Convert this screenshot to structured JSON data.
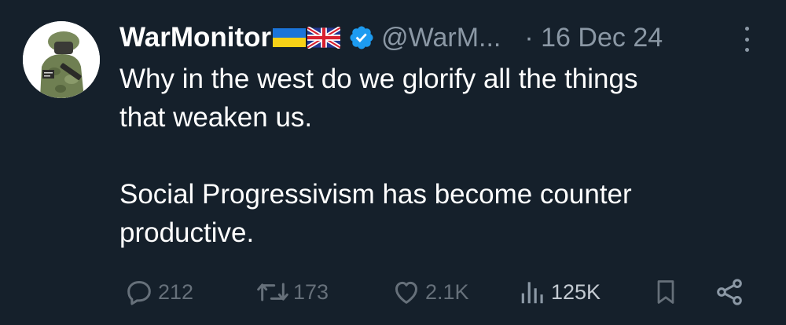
{
  "tweet": {
    "display_name": "WarMonitor",
    "flags": [
      "ukraine-flag-icon",
      "uk-flag-icon"
    ],
    "verified_icon": "verified-badge-icon",
    "handle": "@WarM...",
    "date": "· 16 Dec 24",
    "text_lines": [
      "Why in the west do we glorify all the things",
      "that weaken us.",
      "",
      "Social Progressivism has become counter",
      "productive."
    ]
  },
  "actions": {
    "reply": {
      "icon": "reply-icon",
      "count": "212"
    },
    "retweet": {
      "icon": "retweet-icon",
      "count": "173"
    },
    "like": {
      "icon": "heart-icon",
      "count": "2.1K"
    },
    "views": {
      "icon": "views-chart-icon",
      "count": "125K"
    },
    "bookmark": {
      "icon": "bookmark-icon"
    },
    "share": {
      "icon": "share-icon"
    }
  },
  "colors": {
    "background": "#15202b",
    "primary_text": "#ffffff",
    "secondary_text": "#8b98a5",
    "action_icons": "#66707a",
    "verified_blue": "#1d9bf0"
  }
}
